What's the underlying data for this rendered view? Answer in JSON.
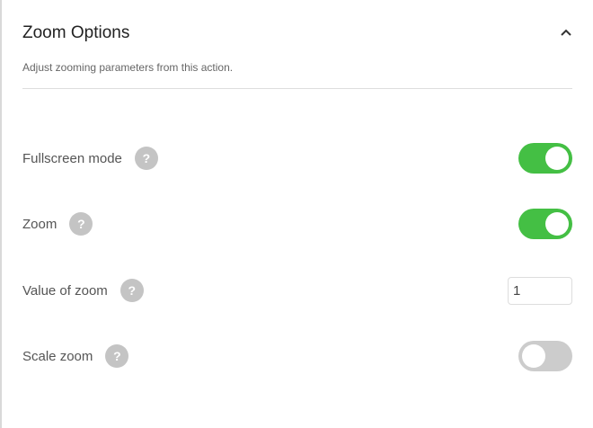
{
  "panel": {
    "title": "Zoom Options",
    "subtitle": "Adjust zooming parameters from this action.",
    "collapse_icon": "chevron-up-icon"
  },
  "colors": {
    "toggle_on": "#44bf44",
    "toggle_off": "#cccccc",
    "help": "#c4c4c4"
  },
  "settings": [
    {
      "label": "Fullscreen mode",
      "type": "toggle",
      "on": true,
      "help": "?"
    },
    {
      "label": "Zoom",
      "type": "toggle",
      "on": true,
      "help": "?"
    },
    {
      "label": "Value of zoom",
      "type": "number",
      "value": "1",
      "help": "?"
    },
    {
      "label": "Scale zoom",
      "type": "toggle",
      "on": false,
      "help": "?"
    }
  ]
}
